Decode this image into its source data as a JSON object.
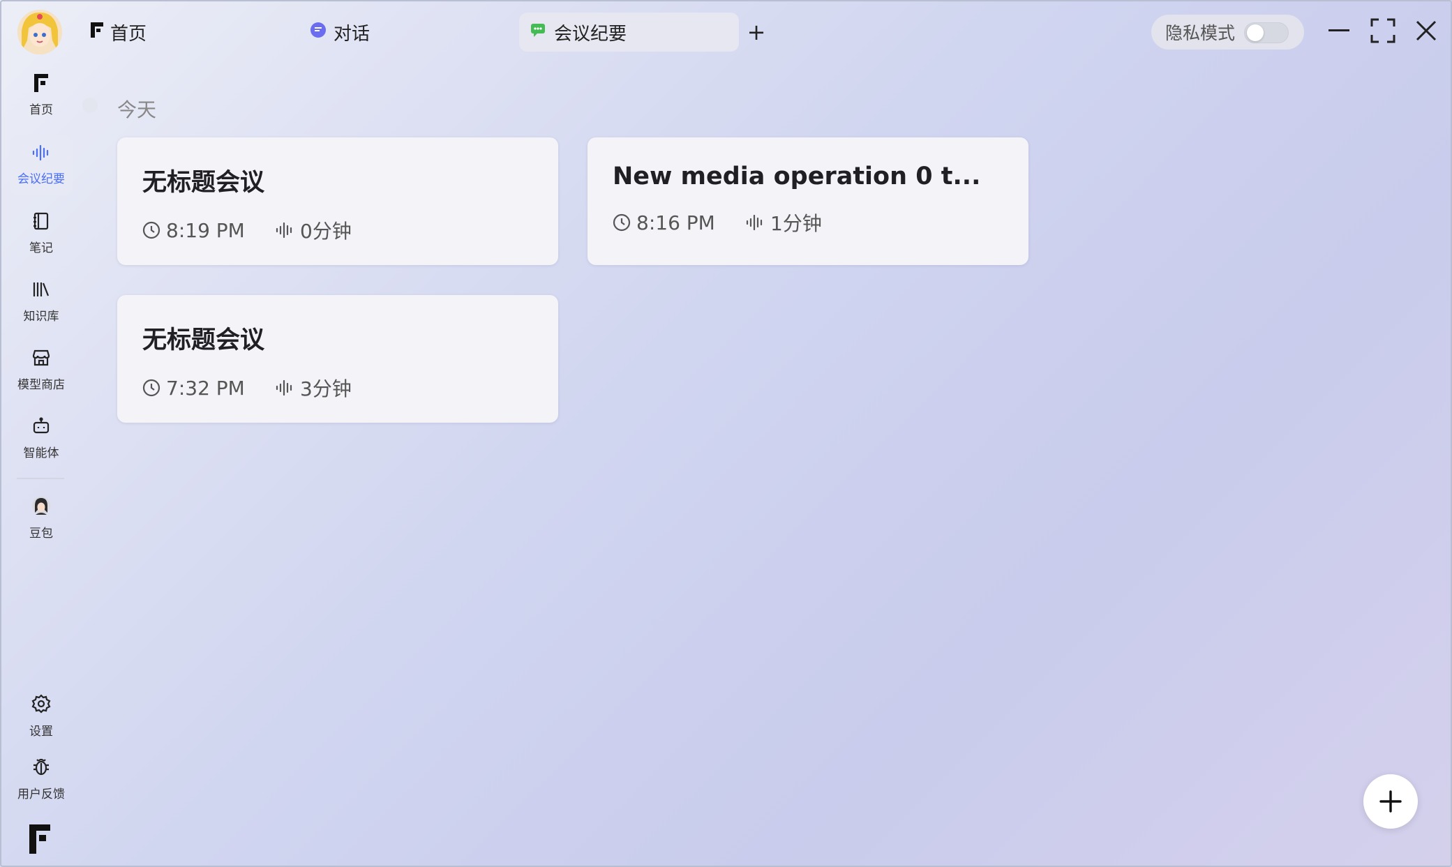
{
  "topbar": {
    "tabs": [
      {
        "label": "首页",
        "icon": "app-logo-icon"
      },
      {
        "label": "对话",
        "icon": "chat-bubble-icon",
        "icon_color": "#6b6df0"
      },
      {
        "label": "会议纪要",
        "icon": "meeting-chat-icon",
        "icon_color": "#44bb55"
      }
    ],
    "add_tab_label": "+",
    "privacy_label": "隐私模式",
    "privacy_on": false
  },
  "sidebar": {
    "items": [
      {
        "label": "首页",
        "icon": "app-logo-icon"
      },
      {
        "label": "会议纪要",
        "icon": "waveform-icon",
        "active": true
      },
      {
        "label": "笔记",
        "icon": "notebook-icon"
      },
      {
        "label": "知识库",
        "icon": "books-icon"
      },
      {
        "label": "模型商店",
        "icon": "store-icon"
      },
      {
        "label": "智能体",
        "icon": "robot-icon"
      },
      {
        "label": "豆包",
        "icon": "doubao-avatar-icon"
      }
    ],
    "bottom": [
      {
        "label": "设置",
        "icon": "gear-icon"
      },
      {
        "label": "用户反馈",
        "icon": "bug-icon"
      }
    ]
  },
  "main": {
    "date_group": "今天",
    "meetings": [
      {
        "title": "无标题会议",
        "time": "8:19 PM",
        "duration": "0分钟"
      },
      {
        "title": "New media operation 0 t...",
        "time": "8:16 PM",
        "duration": "1分钟"
      },
      {
        "title": "无标题会议",
        "time": "7:32 PM",
        "duration": "3分钟"
      }
    ],
    "fab_label": "+"
  },
  "colors": {
    "accent": "#4a6ef5",
    "card_bg": "#f3f3f8"
  }
}
